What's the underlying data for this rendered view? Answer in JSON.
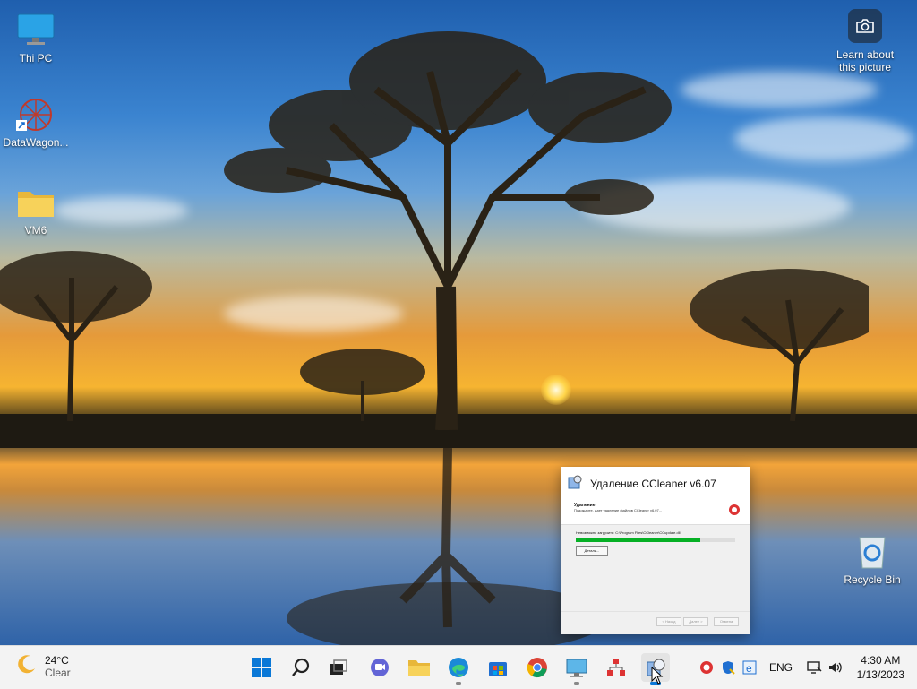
{
  "desktop": {
    "icons": [
      {
        "label": "Thi PC",
        "icon": "monitor-icon"
      },
      {
        "label": "DataWagon...",
        "icon": "datawagon-app-icon"
      },
      {
        "label": "VM6",
        "icon": "folder-icon"
      },
      {
        "label": "Recycle Bin",
        "icon": "recycle-bin-icon"
      }
    ],
    "learn_about": {
      "line1": "Learn about",
      "line2": "this picture"
    }
  },
  "dialog": {
    "title": "Удаление CCleaner v6.07",
    "section_heading": "Удаление",
    "section_desc": "Подождите, идет удаление файлов CCleaner v6.07...",
    "status_text": "Невозможно загрузить: C:\\Program Files\\CCleaner\\CCupdate.dll",
    "progress_fraction": 0.78,
    "details_button": "Детали...",
    "footer_buttons": [
      "< Назад",
      "Далее >",
      "Отмена"
    ],
    "colors": {
      "progress": "#06b025"
    }
  },
  "taskbar": {
    "weather": {
      "temp": "24°C",
      "condition": "Clear"
    },
    "pinned": [
      "windows-start-icon",
      "search-icon",
      "task-view-icon",
      "teams-chat-icon",
      "file-explorer-icon",
      "edge-browser-icon",
      "microsoft-store-icon",
      "chrome-icon",
      "remote-desktop-icon",
      "network-tool-icon",
      "ccleaner-uninstaller-icon"
    ],
    "tray": {
      "language": "ENG"
    },
    "clock": {
      "time": "4:30 AM",
      "date": "1/13/2023"
    }
  }
}
